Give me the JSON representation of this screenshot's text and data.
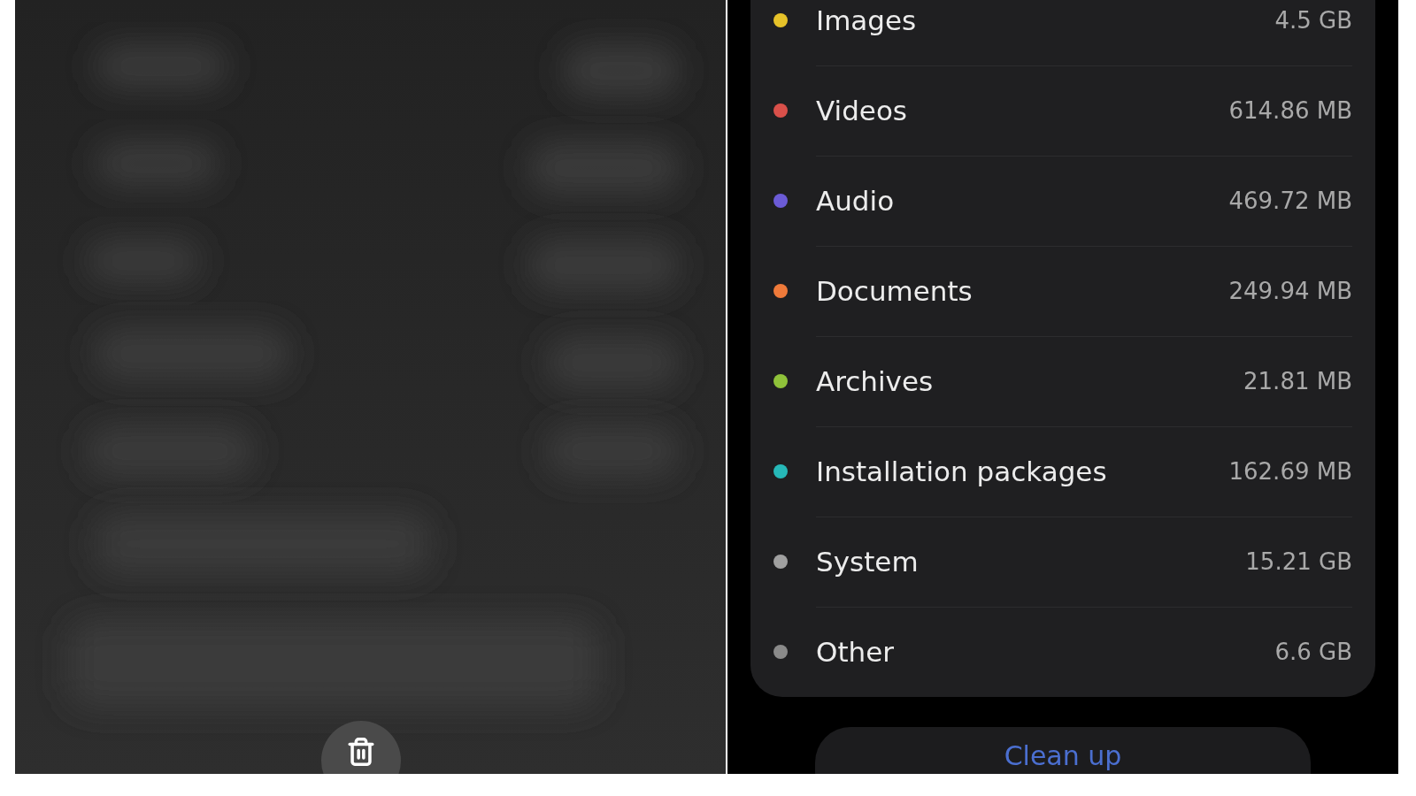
{
  "storage_categories": [
    {
      "name": "Images",
      "size": "4.5 GB",
      "color": "#e6c229"
    },
    {
      "name": "Videos",
      "size": "614.86 MB",
      "color": "#d9504a"
    },
    {
      "name": "Audio",
      "size": "469.72 MB",
      "color": "#6b5bd6"
    },
    {
      "name": "Documents",
      "size": "249.94 MB",
      "color": "#ef7a3a"
    },
    {
      "name": "Archives",
      "size": "21.81 MB",
      "color": "#8fc23a"
    },
    {
      "name": "Installation packages",
      "size": "162.69 MB",
      "color": "#26b8b8"
    },
    {
      "name": "System",
      "size": "15.21 GB",
      "color": "#a0a0a0"
    },
    {
      "name": "Other",
      "size": "6.6 GB",
      "color": "#8a8a8a"
    }
  ],
  "clean_up_button": {
    "label": "Clean up"
  }
}
